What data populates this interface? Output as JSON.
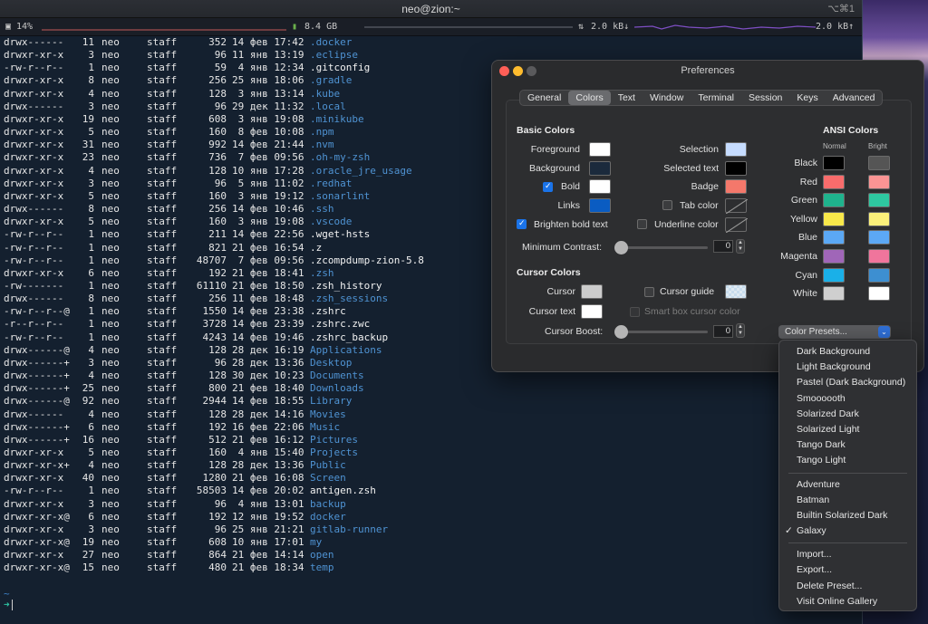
{
  "window_title": "neo@zion:~",
  "window_shortcut": "⌥⌘1",
  "status_bar": {
    "cpu": "14%",
    "memory": "8.4 GB",
    "net_down": "2.0 kB↓",
    "net_up": "2.0 kB↑"
  },
  "listing": [
    {
      "perm": "drwx------",
      "links": "11",
      "user": "neo",
      "group": "staff",
      "size": "352",
      "date": "14 фев 17:42",
      "name": ".docker",
      "dir": true
    },
    {
      "perm": "drwxr-xr-x",
      "links": "3",
      "user": "neo",
      "group": "staff",
      "size": "96",
      "date": "11 янв 13:19",
      "name": ".eclipse",
      "dir": true
    },
    {
      "perm": "-rw-r--r--",
      "links": "1",
      "user": "neo",
      "group": "staff",
      "size": "59",
      "date": " 4 янв 12:34",
      "name": ".gitconfig",
      "dir": false
    },
    {
      "perm": "drwxr-xr-x",
      "links": "8",
      "user": "neo",
      "group": "staff",
      "size": "256",
      "date": "25 янв 18:06",
      "name": ".gradle",
      "dir": true
    },
    {
      "perm": "drwxr-xr-x",
      "links": "4",
      "user": "neo",
      "group": "staff",
      "size": "128",
      "date": " 3 янв 13:14",
      "name": ".kube",
      "dir": true
    },
    {
      "perm": "drwx------",
      "links": "3",
      "user": "neo",
      "group": "staff",
      "size": "96",
      "date": "29 дек 11:32",
      "name": ".local",
      "dir": true
    },
    {
      "perm": "drwxr-xr-x",
      "links": "19",
      "user": "neo",
      "group": "staff",
      "size": "608",
      "date": " 3 янв 19:08",
      "name": ".minikube",
      "dir": true
    },
    {
      "perm": "drwxr-xr-x",
      "links": "5",
      "user": "neo",
      "group": "staff",
      "size": "160",
      "date": " 8 фев 10:08",
      "name": ".npm",
      "dir": true
    },
    {
      "perm": "drwxr-xr-x",
      "links": "31",
      "user": "neo",
      "group": "staff",
      "size": "992",
      "date": "14 фев 21:44",
      "name": ".nvm",
      "dir": true
    },
    {
      "perm": "drwxr-xr-x",
      "links": "23",
      "user": "neo",
      "group": "staff",
      "size": "736",
      "date": " 7 фев 09:56",
      "name": ".oh-my-zsh",
      "dir": true
    },
    {
      "perm": "drwxr-xr-x",
      "links": "4",
      "user": "neo",
      "group": "staff",
      "size": "128",
      "date": "10 янв 17:28",
      "name": ".oracle_jre_usage",
      "dir": true
    },
    {
      "perm": "drwxr-xr-x",
      "links": "3",
      "user": "neo",
      "group": "staff",
      "size": "96",
      "date": " 5 янв 11:02",
      "name": ".redhat",
      "dir": true
    },
    {
      "perm": "drwxr-xr-x",
      "links": "5",
      "user": "neo",
      "group": "staff",
      "size": "160",
      "date": " 3 янв 19:12",
      "name": ".sonarlint",
      "dir": true
    },
    {
      "perm": "drwx------",
      "links": "8",
      "user": "neo",
      "group": "staff",
      "size": "256",
      "date": "14 фев 10:46",
      "name": ".ssh",
      "dir": true
    },
    {
      "perm": "drwxr-xr-x",
      "links": "5",
      "user": "neo",
      "group": "staff",
      "size": "160",
      "date": " 3 янв 19:08",
      "name": ".vscode",
      "dir": true
    },
    {
      "perm": "-rw-r--r--",
      "links": "1",
      "user": "neo",
      "group": "staff",
      "size": "211",
      "date": "14 фев 22:56",
      "name": ".wget-hsts",
      "dir": false
    },
    {
      "perm": "-rw-r--r--",
      "links": "1",
      "user": "neo",
      "group": "staff",
      "size": "821",
      "date": "21 фев 16:54",
      "name": ".z",
      "dir": false
    },
    {
      "perm": "-rw-r--r--",
      "links": "1",
      "user": "neo",
      "group": "staff",
      "size": "48707",
      "date": " 7 фев 09:56",
      "name": ".zcompdump-zion-5.8",
      "dir": false
    },
    {
      "perm": "drwxr-xr-x",
      "links": "6",
      "user": "neo",
      "group": "staff",
      "size": "192",
      "date": "21 фев 18:41",
      "name": ".zsh",
      "dir": true
    },
    {
      "perm": "-rw-------",
      "links": "1",
      "user": "neo",
      "group": "staff",
      "size": "61110",
      "date": "21 фев 18:50",
      "name": ".zsh_history",
      "dir": false
    },
    {
      "perm": "drwx------",
      "links": "8",
      "user": "neo",
      "group": "staff",
      "size": "256",
      "date": "11 фев 18:48",
      "name": ".zsh_sessions",
      "dir": true
    },
    {
      "perm": "-rw-r--r--@",
      "links": "1",
      "user": "neo",
      "group": "staff",
      "size": "1550",
      "date": "14 фев 23:38",
      "name": ".zshrc",
      "dir": false
    },
    {
      "perm": "-r--r--r--",
      "links": "1",
      "user": "neo",
      "group": "staff",
      "size": "3728",
      "date": "14 фев 23:39",
      "name": ".zshrc.zwc",
      "dir": false
    },
    {
      "perm": "-rw-r--r--",
      "links": "1",
      "user": "neo",
      "group": "staff",
      "size": "4243",
      "date": "14 фев 19:46",
      "name": ".zshrc_backup",
      "dir": false
    },
    {
      "perm": "drwx------@",
      "links": "4",
      "user": "neo",
      "group": "staff",
      "size": "128",
      "date": "28 дек 16:19",
      "name": "Applications",
      "dir": true
    },
    {
      "perm": "drwx------+",
      "links": "3",
      "user": "neo",
      "group": "staff",
      "size": "96",
      "date": "28 дек 13:36",
      "name": "Desktop",
      "dir": true
    },
    {
      "perm": "drwx------+",
      "links": "4",
      "user": "neo",
      "group": "staff",
      "size": "128",
      "date": "30 дек 10:23",
      "name": "Documents",
      "dir": true
    },
    {
      "perm": "drwx------+",
      "links": "25",
      "user": "neo",
      "group": "staff",
      "size": "800",
      "date": "21 фев 18:40",
      "name": "Downloads",
      "dir": true
    },
    {
      "perm": "drwx------@",
      "links": "92",
      "user": "neo",
      "group": "staff",
      "size": "2944",
      "date": "14 фев 18:55",
      "name": "Library",
      "dir": true
    },
    {
      "perm": "drwx------",
      "links": "4",
      "user": "neo",
      "group": "staff",
      "size": "128",
      "date": "28 дек 14:16",
      "name": "Movies",
      "dir": true
    },
    {
      "perm": "drwx------+",
      "links": "6",
      "user": "neo",
      "group": "staff",
      "size": "192",
      "date": "16 фев 22:06",
      "name": "Music",
      "dir": true
    },
    {
      "perm": "drwx------+",
      "links": "16",
      "user": "neo",
      "group": "staff",
      "size": "512",
      "date": "21 фев 16:12",
      "name": "Pictures",
      "dir": true
    },
    {
      "perm": "drwxr-xr-x",
      "links": "5",
      "user": "neo",
      "group": "staff",
      "size": "160",
      "date": " 4 янв 15:40",
      "name": "Projects",
      "dir": true
    },
    {
      "perm": "drwxr-xr-x+",
      "links": "4",
      "user": "neo",
      "group": "staff",
      "size": "128",
      "date": "28 дек 13:36",
      "name": "Public",
      "dir": true
    },
    {
      "perm": "drwxr-xr-x",
      "links": "40",
      "user": "neo",
      "group": "staff",
      "size": "1280",
      "date": "21 фев 16:08",
      "name": "Screen",
      "dir": true
    },
    {
      "perm": "-rw-r--r--",
      "links": "1",
      "user": "neo",
      "group": "staff",
      "size": "58503",
      "date": "14 фев 20:02",
      "name": "antigen.zsh",
      "dir": false
    },
    {
      "perm": "drwxr-xr-x",
      "links": "3",
      "user": "neo",
      "group": "staff",
      "size": "96",
      "date": " 4 янв 13:01",
      "name": "backup",
      "dir": true
    },
    {
      "perm": "drwxr-xr-x@",
      "links": "6",
      "user": "neo",
      "group": "staff",
      "size": "192",
      "date": "12 янв 19:52",
      "name": "docker",
      "dir": true
    },
    {
      "perm": "drwxr-xr-x",
      "links": "3",
      "user": "neo",
      "group": "staff",
      "size": "96",
      "date": "25 янв 21:21",
      "name": "gitlab-runner",
      "dir": true
    },
    {
      "perm": "drwxr-xr-x@",
      "links": "19",
      "user": "neo",
      "group": "staff",
      "size": "608",
      "date": "10 янв 17:01",
      "name": "my",
      "dir": true
    },
    {
      "perm": "drwxr-xr-x",
      "links": "27",
      "user": "neo",
      "group": "staff",
      "size": "864",
      "date": "21 фев 14:14",
      "name": "open",
      "dir": true
    },
    {
      "perm": "drwxr-xr-x@",
      "links": "15",
      "user": "neo",
      "group": "staff",
      "size": "480",
      "date": "21 фев 18:34",
      "name": "temp",
      "dir": true
    }
  ],
  "prompt": {
    "path": "~",
    "arrow": "➜"
  },
  "prefs": {
    "title": "Preferences",
    "tabs": [
      "General",
      "Colors",
      "Text",
      "Window",
      "Terminal",
      "Session",
      "Keys",
      "Advanced"
    ],
    "active_tab": "Colors",
    "basic_colors_heading": "Basic Colors",
    "basic": {
      "foreground": {
        "label": "Foreground",
        "color": "#ffffff"
      },
      "background": {
        "label": "Background",
        "color": "#1b2a3c"
      },
      "bold": {
        "label": "Bold",
        "color": "#ffffff",
        "checked": true
      },
      "links": {
        "label": "Links",
        "color": "#0a5cc2"
      },
      "brighten": {
        "label": "Brighten bold text",
        "checked": true
      },
      "selection": {
        "label": "Selection",
        "color": "#c6dcff"
      },
      "selected_text": {
        "label": "Selected text",
        "color": "#000000"
      },
      "badge": {
        "label": "Badge",
        "color": "#f4786b"
      },
      "tab_color": {
        "label": "Tab color",
        "checked": false
      },
      "underline_color": {
        "label": "Underline color",
        "checked": false
      },
      "min_contrast": {
        "label": "Minimum Contrast:",
        "value": "0"
      }
    },
    "cursor_colors_heading": "Cursor Colors",
    "cursor": {
      "cursor": {
        "label": "Cursor",
        "color": "#cccccc"
      },
      "cursor_text": {
        "label": "Cursor text",
        "color": "#ffffff"
      },
      "cursor_guide": {
        "label": "Cursor guide",
        "checked": false,
        "color": "#c8ddee"
      },
      "smart_box": {
        "label": "Smart box cursor color",
        "checked": false
      },
      "boost": {
        "label": "Cursor Boost:",
        "value": "0"
      }
    },
    "ansi_heading": "ANSI Colors",
    "ansi_normal_label": "Normal",
    "ansi_bright_label": "Bright",
    "ansi": [
      {
        "name": "Black",
        "normal": "#000000",
        "bright": "#555555"
      },
      {
        "name": "Red",
        "normal": "#f96c6c",
        "bright": "#fa9494"
      },
      {
        "name": "Green",
        "normal": "#1fb38d",
        "bright": "#2ec7a0"
      },
      {
        "name": "Yellow",
        "normal": "#f8e84a",
        "bright": "#fbf07a"
      },
      {
        "name": "Blue",
        "normal": "#5ba8f4",
        "bright": "#5ca8f5"
      },
      {
        "name": "Magenta",
        "normal": "#a066b8",
        "bright": "#f0759c"
      },
      {
        "name": "Cyan",
        "normal": "#1ab0e8",
        "bright": "#3d8fd1"
      },
      {
        "name": "White",
        "normal": "#cfcfcf",
        "bright": "#ffffff"
      }
    ],
    "presets_button": "Color Presets..."
  },
  "presets_menu": {
    "group1": [
      "Dark Background",
      "Light Background",
      "Pastel (Dark Background)",
      "Smoooooth",
      "Solarized Dark",
      "Solarized Light",
      "Tango Dark",
      "Tango Light"
    ],
    "group2": [
      "Adventure",
      "Batman",
      "Builtin Solarized Dark",
      "Galaxy"
    ],
    "checked": "Galaxy",
    "group3": [
      "Import...",
      "Export...",
      "Delete Preset...",
      "Visit Online Gallery"
    ]
  }
}
